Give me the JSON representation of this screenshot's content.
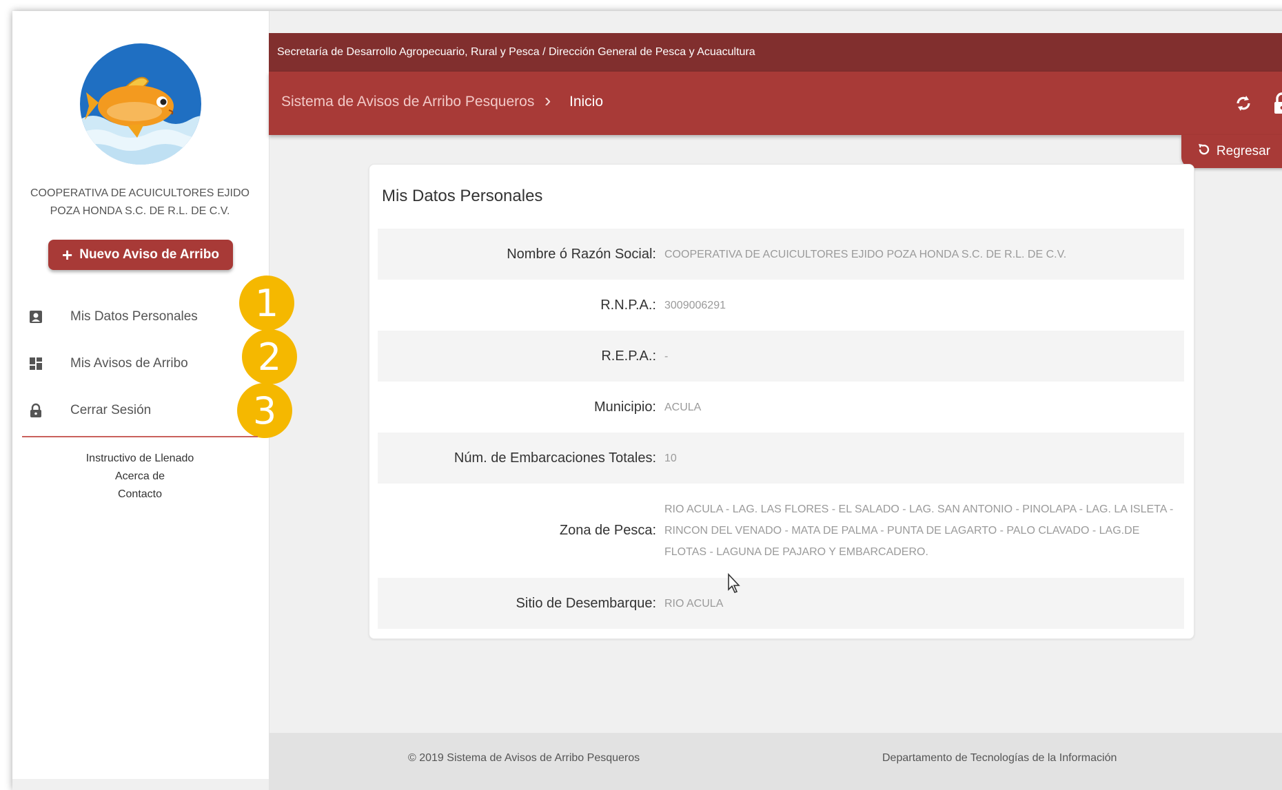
{
  "header": {
    "agency": "Secretaría de Desarrollo Agropecuario, Rural y Pesca / Dirección General de Pesca y Acuacultura",
    "breadcrumb": [
      "Sistema de Avisos de Arribo Pesqueros",
      "Inicio"
    ],
    "back_label": "Regresar"
  },
  "sidebar": {
    "org_name": "COOPERATIVA DE ACUICULTORES EJIDO POZA HONDA S.C. DE R.L. DE C.V.",
    "new_button": "Nuevo Aviso de Arribo",
    "menu": [
      {
        "label": "Mis Datos Personales",
        "icon": "account-box-icon"
      },
      {
        "label": "Mis Avisos de Arribo",
        "icon": "dashboard-icon"
      },
      {
        "label": "Cerrar Sesión",
        "icon": "lock-icon"
      }
    ],
    "links": [
      "Instructivo de Llenado",
      "Acerca de",
      "Contacto"
    ],
    "badges": [
      "1",
      "2",
      "3"
    ],
    "badge_color": "#f5b800"
  },
  "card": {
    "title": "Mis Datos Personales",
    "rows": [
      {
        "label": "Nombre ó Razón Social:",
        "value": "COOPERATIVA DE ACUICULTORES EJIDO POZA HONDA S.C. DE R.L. DE C.V."
      },
      {
        "label": "R.N.P.A.:",
        "value": "3009006291"
      },
      {
        "label": "R.E.P.A.:",
        "value": "-"
      },
      {
        "label": "Municipio:",
        "value": "ACULA"
      },
      {
        "label": "Núm. de Embarcaciones Totales:",
        "value": "10"
      },
      {
        "label": "Zona de Pesca:",
        "value": "RIO ACULA - LAG. LAS FLORES - EL SALADO - LAG. SAN ANTONIO - PINOLAPA - LAG. LA ISLETA - RINCON DEL VENADO - MATA DE PALMA - PUNTA DE LAGARTO - PALO CLAVADO - LAG.DE FLOTAS - LAGUNA DE PAJARO Y EMBARCADERO."
      },
      {
        "label": "Sitio de Desembarque:",
        "value": "RIO ACULA"
      }
    ]
  },
  "footer": {
    "left": "© 2019 Sistema de Avisos de Arribo Pesqueros",
    "right": "Departamento de Tecnologías de la Información"
  },
  "colors": {
    "primary": "#a83a37",
    "primary_dark": "#812f2e"
  }
}
